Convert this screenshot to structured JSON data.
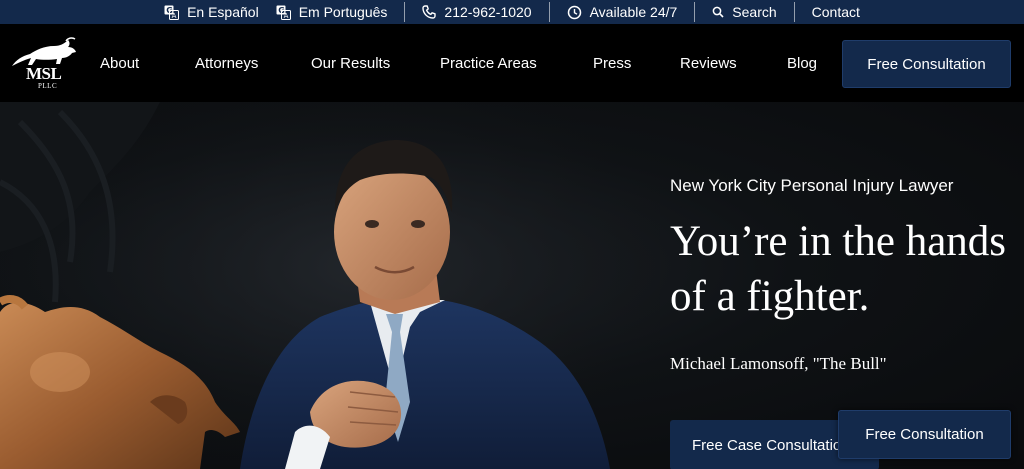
{
  "colors": {
    "topbar_bg": "#13294b",
    "nav_bg": "#000000",
    "button_bg": "#13294b",
    "hero_bg": "#0f1215",
    "text": "#ffffff"
  },
  "topbar": {
    "items": [
      {
        "label": "En Español",
        "icon": "translate-icon"
      },
      {
        "label": "Em Português",
        "icon": "translate-icon"
      },
      {
        "label": "212-962-1020",
        "icon": "phone-icon"
      },
      {
        "label": "Available 24/7",
        "icon": "clock-icon"
      },
      {
        "label": "Search",
        "icon": "search-icon"
      },
      {
        "label": "Contact",
        "icon": ""
      }
    ]
  },
  "logo": {
    "name": "MSL",
    "sub": "PLLC"
  },
  "nav": {
    "items": [
      "About",
      "Attorneys",
      "Our Results",
      "Practice Areas",
      "Press",
      "Reviews",
      "Blog"
    ],
    "cta": "Free Consultation"
  },
  "hero": {
    "subtitle": "New York City Personal Injury Lawyer",
    "title": "You’re in the hands of a fighter.",
    "quote": "Michael Lamonsoff, \"The Bull\"",
    "case_button": "Free Case Consultation",
    "floating_button": "Free Consultation"
  }
}
